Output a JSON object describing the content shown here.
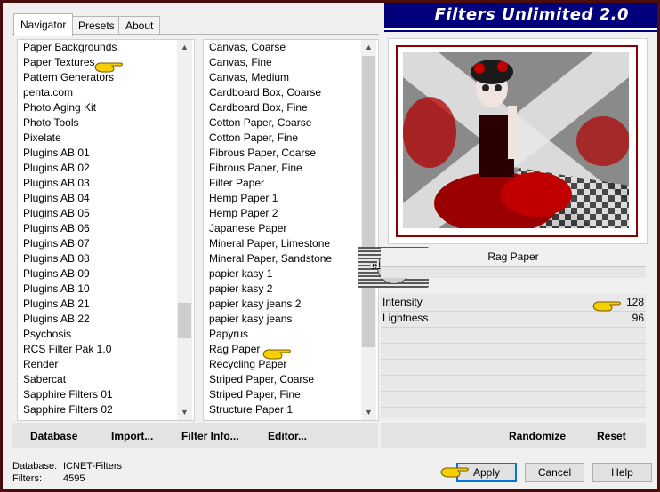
{
  "window": {
    "title": "Filters Unlimited 2.0"
  },
  "tabs": [
    {
      "label": "Navigator",
      "active": true
    },
    {
      "label": "Presets",
      "active": false
    },
    {
      "label": "About",
      "active": false
    }
  ],
  "categories": {
    "items": [
      "Paper Backgrounds",
      "Paper Textures",
      "Pattern Generators",
      "penta.com",
      "Photo Aging Kit",
      "Photo Tools",
      "Pixelate",
      "Plugins AB 01",
      "Plugins AB 02",
      "Plugins AB 03",
      "Plugins AB 04",
      "Plugins AB 05",
      "Plugins AB 06",
      "Plugins AB 07",
      "Plugins AB 08",
      "Plugins AB 09",
      "Plugins AB 10",
      "Plugins AB 21",
      "Plugins AB 22",
      "Psychosis",
      "RCS Filter Pak 1.0",
      "Render",
      "Sabercat",
      "Sapphire Filters 01",
      "Sapphire Filters 02"
    ],
    "selected": "Paper Textures"
  },
  "filters": {
    "items": [
      "Canvas, Coarse",
      "Canvas, Fine",
      "Canvas, Medium",
      "Cardboard Box, Coarse",
      "Cardboard Box, Fine",
      "Cotton Paper, Coarse",
      "Cotton Paper, Fine",
      "Fibrous Paper, Coarse",
      "Fibrous Paper, Fine",
      "Filter Paper",
      "Hemp Paper 1",
      "Hemp Paper 2",
      "Japanese Paper",
      "Mineral Paper, Limestone",
      "Mineral Paper, Sandstone",
      "papier kasy 1",
      "papier kasy 2",
      "papier kasy jeans 2",
      "papier kasy jeans",
      "Papyrus",
      "Rag Paper",
      "Recycling Paper",
      "Striped Paper, Coarse",
      "Striped Paper, Fine",
      "Structure Paper 1"
    ],
    "selected": "Rag Paper"
  },
  "filter_panel": {
    "name": "Rag Paper",
    "params": [
      {
        "label": "Intensity",
        "value": "128"
      },
      {
        "label": "Lightness",
        "value": "96"
      }
    ]
  },
  "toolbar": {
    "database": "Database",
    "import": "Import...",
    "filter_info": "Filter Info...",
    "editor": "Editor...",
    "randomize": "Randomize",
    "reset": "Reset"
  },
  "status": {
    "database_label": "Database:",
    "database_value": "ICNET-Filters",
    "filters_label": "Filters:",
    "filters_value": "4595"
  },
  "buttons": {
    "apply": "Apply",
    "cancel": "Cancel",
    "help": "Help"
  },
  "watermark": {
    "text": "claudia"
  },
  "colors": {
    "banner": "#00007a",
    "frame": "#4a0c0c",
    "selection": "#3399ff",
    "pointer": "#f5d000"
  }
}
